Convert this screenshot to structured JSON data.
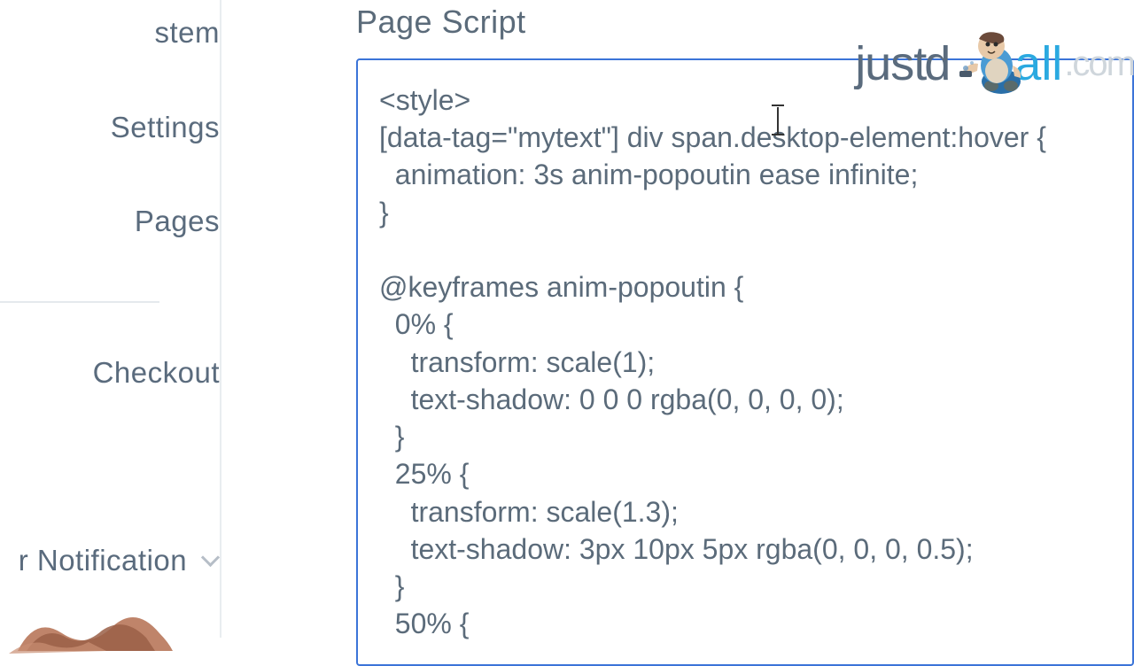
{
  "sidebar": {
    "items": [
      {
        "label": "stem"
      },
      {
        "label": "Settings"
      },
      {
        "label": " Pages"
      },
      {
        "label": "Checkout"
      },
      {
        "label": "r Notification"
      }
    ]
  },
  "main": {
    "section_title": "Page Script",
    "code": "<style>\n[data-tag=\"mytext\"] div span.desktop-element:hover {\n  animation: 3s anim-popoutin ease infinite;\n}\n\n@keyframes anim-popoutin {\n  0% {\n    transform: scale(1);\n    text-shadow: 0 0 0 rgba(0, 0, 0, 0);\n  }\n  25% {\n    transform: scale(1.3);\n    text-shadow: 3px 10px 5px rgba(0, 0, 0, 0.5);\n  }\n  50% {"
  },
  "watermark": {
    "just": "just",
    "d": "d",
    "all": "all",
    "com": ".com"
  }
}
